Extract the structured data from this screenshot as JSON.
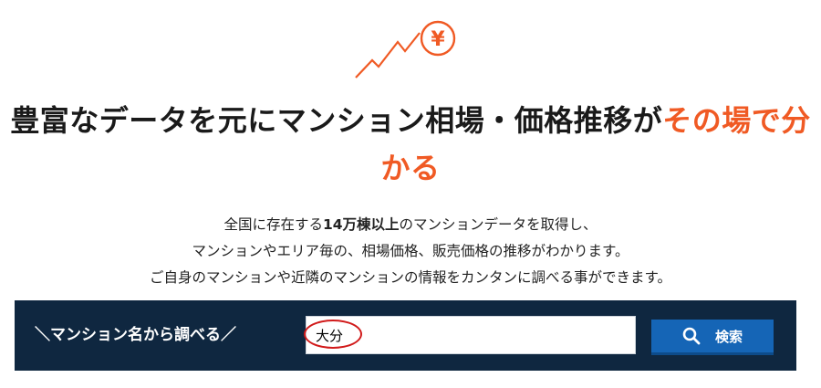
{
  "hero": {
    "icon": "rising-chart-yen-icon",
    "accent_color": "#f05a24",
    "yen_symbol": "¥"
  },
  "headline": {
    "main": "豊富なデータを元にマンション相場・価格推移が",
    "accent_part1": "その場で分",
    "accent_part2": "かる"
  },
  "description": {
    "line1_before": "全国に存在する",
    "line1_bold": "14万棟以上",
    "line1_after": "のマンションデータを取得し、",
    "line2": "マンションやエリア毎の、相場価格、販売価格の推移がわかります。",
    "line3": "ご自身のマンションや近隣のマンションの情報をカンタンに調べる事ができます。"
  },
  "search": {
    "label": "＼マンション名から調べる／",
    "input_value": "大分",
    "button_label": "検索",
    "button_icon": "search-icon",
    "bar_color": "#0f2740",
    "button_color": "#1565b6"
  }
}
